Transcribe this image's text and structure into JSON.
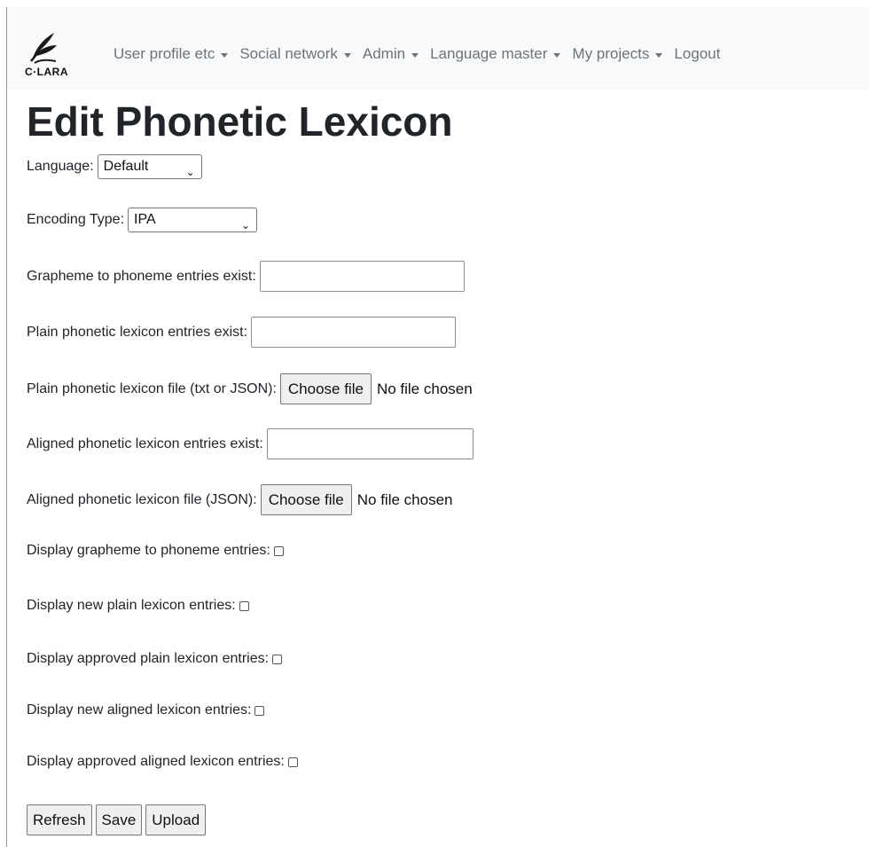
{
  "nav": {
    "logo_text": "C·LARA",
    "items": [
      {
        "label": "User profile etc",
        "dropdown": true
      },
      {
        "label": "Social network",
        "dropdown": true
      },
      {
        "label": "Admin",
        "dropdown": true
      },
      {
        "label": "Language master",
        "dropdown": true
      },
      {
        "label": "My projects",
        "dropdown": true
      },
      {
        "label": "Logout",
        "dropdown": false
      }
    ]
  },
  "page": {
    "title": "Edit Phonetic Lexicon"
  },
  "form": {
    "language_label": "Language:",
    "language_value": "Default",
    "encoding_label": "Encoding Type:",
    "encoding_value": "IPA",
    "g2p_exist_label": "Grapheme to phoneme entries exist:",
    "g2p_exist_value": "",
    "plain_exist_label": "Plain phonetic lexicon entries exist:",
    "plain_exist_value": "",
    "plain_file_label": "Plain phonetic lexicon file (txt or JSON):",
    "aligned_exist_label": "Aligned phonetic lexicon entries exist:",
    "aligned_exist_value": "",
    "aligned_file_label": "Aligned phonetic lexicon file (JSON):",
    "choose_file_label": "Choose file",
    "no_file_text": "No file chosen",
    "display_g2p_label": "Display grapheme to phoneme entries:",
    "display_new_plain_label": "Display new plain lexicon entries:",
    "display_approved_plain_label": "Display approved plain lexicon entries:",
    "display_new_aligned_label": "Display new aligned lexicon entries:",
    "display_approved_aligned_label": "Display approved aligned lexicon entries:"
  },
  "buttons": {
    "refresh": "Refresh",
    "save": "Save",
    "upload": "Upload"
  },
  "icons": {
    "logo": "quill-pen-logo-icon",
    "dropdown": "caret-down-icon",
    "select": "chevron-down-icon"
  }
}
